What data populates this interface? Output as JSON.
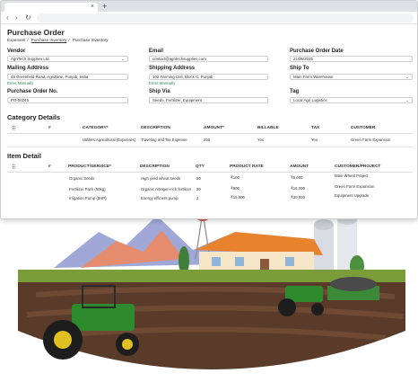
{
  "browser": {
    "tab_close": "×",
    "new_tab": "+",
    "back": "‹",
    "forward": "›",
    "reload": "↻"
  },
  "page": {
    "title": "Purchase Order",
    "breadcrumb": [
      "Expenses",
      "Purchase Inventory",
      "Purchase Inventory"
    ],
    "enter_manually": "Enter Manually"
  },
  "form": {
    "vendor": {
      "label": "Vendor",
      "value": "AgriTech Supplies Ltd."
    },
    "email": {
      "label": "Email",
      "value": "contact@agritechsupplies.com"
    },
    "po_date": {
      "label": "Purchase Order Date",
      "value": "21/05/2025"
    },
    "mailing": {
      "label": "Mailing Address",
      "value": "45 Greenfield Road, AgriZone, Punjab, India"
    },
    "shipping": {
      "label": "Shipping Address",
      "value": "102 Farming Unit, Block C, Punjab"
    },
    "ship_to": {
      "label": "Ship To",
      "value": "Main Farm Warehouse"
    },
    "po_no": {
      "label": "Purchase Order No.",
      "value": "PO-00245"
    },
    "ship_via": {
      "label": "Ship Via",
      "value": "Seeds, Fertilizer, Equipment"
    },
    "tag": {
      "label": "Tag",
      "value": "Local Agri Logistics"
    }
  },
  "category": {
    "title": "Category Details",
    "headers": [
      "#",
      "CATEGORY*",
      "DESCRIPTION",
      "AMOUNT*",
      "BILLABLE",
      "TAX",
      "CUSTOMER"
    ],
    "row": [
      "Utilities:Agricultural (Expenses)",
      "Traveling and Tax Expense",
      "250",
      "Yes",
      "Yes",
      "Green Farm Expansion"
    ]
  },
  "items": {
    "title": "Item Detail",
    "headers": [
      "#",
      "PRODUCT/SERVICE*",
      "DESCRIPTION",
      "QTY",
      "PRODUCT RATE",
      "AMOUNT",
      "CUSTOMER/PROJECT"
    ],
    "rows": [
      [
        "Organic Seeds",
        "High yield wheat seeds",
        "50",
        "₹100",
        "₹5,000",
        "Main Wheat Project"
      ],
      [
        "Fertilizer Pack (50kg)",
        "Organic nitrogen-rich fertilizer",
        "20",
        "₹800",
        "₹16,000",
        "Green Farm Expansion"
      ],
      [
        "Irrigation Pump (5HP)",
        "Energy efficient pump",
        "2",
        "₹15,000",
        "₹30,000",
        "Equipment Upgrade"
      ]
    ]
  }
}
